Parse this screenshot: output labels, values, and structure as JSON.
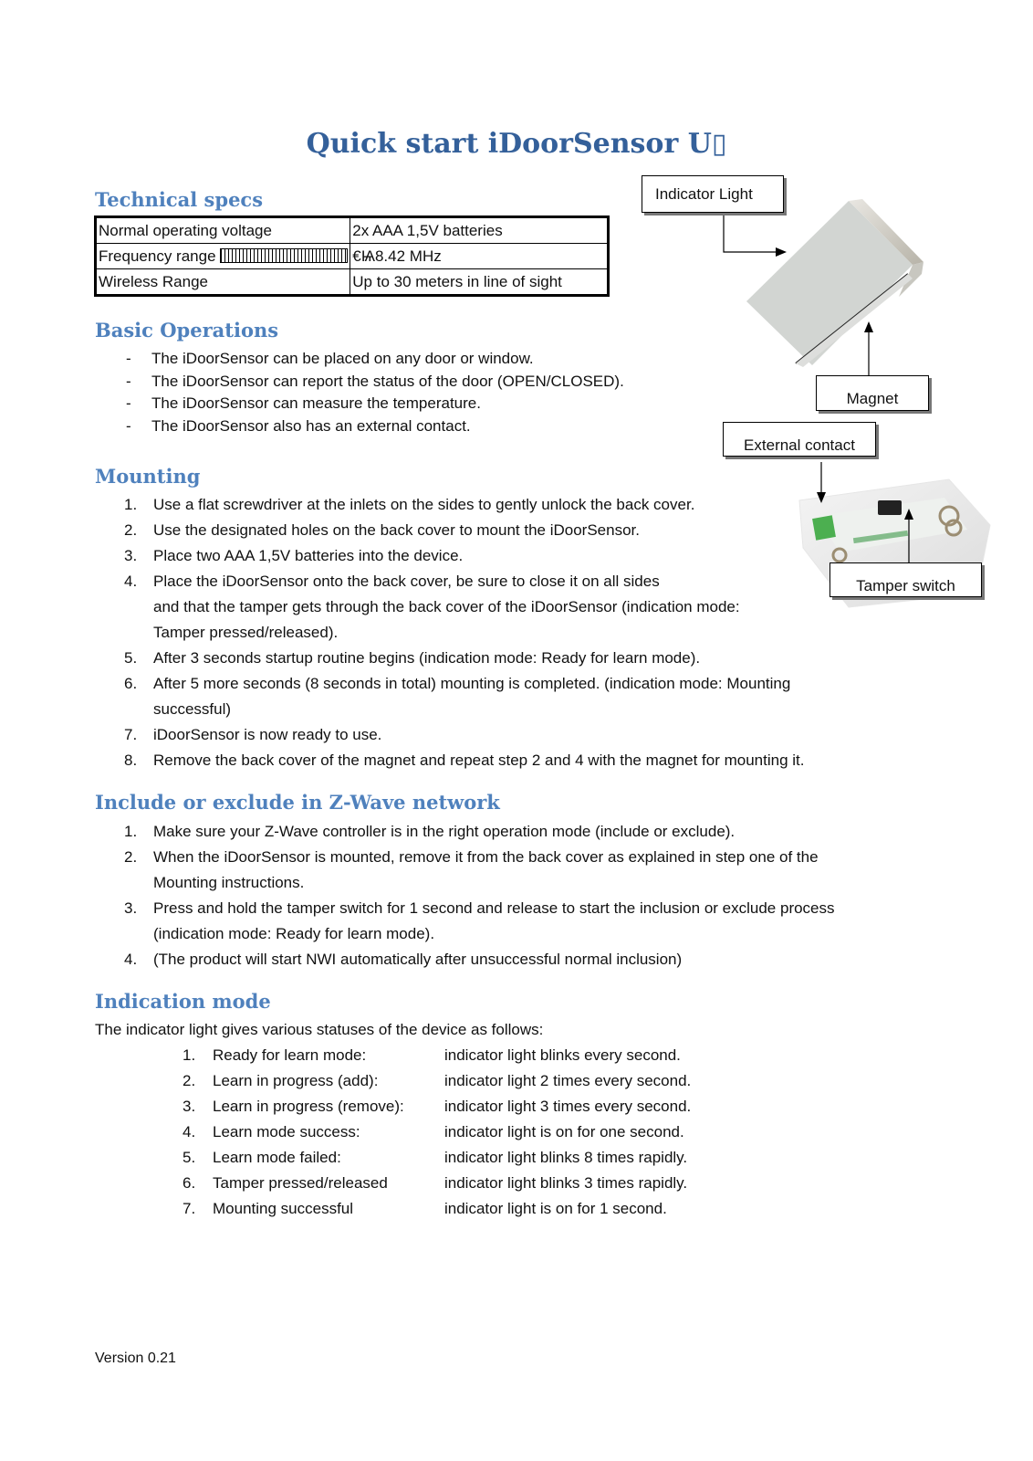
{
  "title": "Quick start iDoorSensor  U▯",
  "sections": {
    "tech_specs": {
      "heading": "Technical specs",
      "rows": [
        {
          "label": "Normal operating voltage",
          "value": "2x AAA 1,5V batteries"
        },
        {
          "label": "Frequency range",
          "value": "€Ѩ8.42 MHz"
        },
        {
          "label": "Wireless Range",
          "value": "Up to 30 meters in line of sight"
        }
      ]
    },
    "basic_operations": {
      "heading": "Basic Operations",
      "marker": "-",
      "items": [
        "The iDoorSensor can be  placed on any door or window.",
        "The iDoorSensor can report the status of the door (OPEN/CLOSED).",
        "The iDoorSensor can measure the temperature.",
        "The iDoorSensor also has  an external contact."
      ]
    },
    "mounting": {
      "heading": "Mounting",
      "items": [
        {
          "num": "1.",
          "text": "Use a flat screwdriver at the inlets on the sides to gently unlock the back cover."
        },
        {
          "num": "2.",
          "text": "Use the designated holes on the back cover to mount the iDoorSensor."
        },
        {
          "num": "3.",
          "text": "Place two AAA 1,5V batteries into the device."
        },
        {
          "num": "4.",
          "text": "Place the iDoorSensor onto  the back cover, be sure to close it on all sides",
          "cont1": " and that the tamper gets through the back cover of the iDoorSensor (indication mode:",
          "cont2": "Tamper pressed/released)."
        },
        {
          "num": "5.",
          "text": "After 3 seconds startup routine begins (indication mode: Ready for learn mode)."
        },
        {
          "num": "6.",
          "text": "After 5 more seconds (8 seconds in total) mounting is completed. (indication mode: Mounting",
          "cont1": "successful)"
        },
        {
          "num": "7.",
          "text": "iDoorSensor is now ready to use."
        },
        {
          "num": "8.",
          "text": "Remove the back cover of the magnet and repeat step 2 and 4 with the magnet for mounting it."
        }
      ]
    },
    "zwave": {
      "heading": "Include or exclude in Z-Wave network",
      "items": [
        {
          "num": "1.",
          "text": "Make sure your Z-Wave controller is in the right operation mode (include or exclude)."
        },
        {
          "num": "2.",
          "text": "When the iDoorSensor is  mounted, remove it from the back cover as explained in step one of the",
          "cont1": "Mounting instructions."
        },
        {
          "num": "3.",
          "text": "Press and hold the tamper switch for 1 second and release to start the inclusion or exclude process",
          "cont1": "(indication mode: Ready for learn mode)."
        },
        {
          "num": "4.",
          "text": "(The product will start NWI automatically after unsuccessful normal inclusion)"
        }
      ]
    },
    "indication": {
      "heading": "Indication mode",
      "intro": "The indicator light gives various statuses of the device as follows:",
      "items": [
        {
          "num": "1.",
          "mode": "Ready for learn mode:",
          "desc": "indicator light blinks every second."
        },
        {
          "num": "2.",
          "mode": "Learn in progress (add):",
          "desc": "indicator light 2 times every second."
        },
        {
          "num": "3.",
          "mode": "Learn in progress (remove):",
          "desc": "indicator light 3 times every second."
        },
        {
          "num": "4.",
          "mode": "Learn mode success:",
          "desc": "indicator light is on for one second."
        },
        {
          "num": "5.",
          "mode": "Learn mode failed:",
          "desc": "indicator light blinks 8 times rapidly."
        },
        {
          "num": "6.",
          "mode": "Tamper pressed/released",
          "desc": "indicator light blinks 3 times rapidly."
        },
        {
          "num": "7.",
          "mode": "Mounting successful",
          "desc": "indicator light is on for 1 second."
        }
      ]
    }
  },
  "figure": {
    "labels": {
      "indicator_light": "Indicator Light",
      "magnet": "Magnet",
      "external_contact": "External contact",
      "tamper_switch": "Tamper switch"
    }
  },
  "footer": {
    "version": "Version 0.21"
  },
  "colors": {
    "title": "#34609a",
    "heading": "#4f81bd"
  }
}
